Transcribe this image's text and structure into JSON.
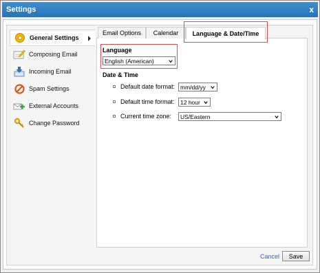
{
  "dialog": {
    "title": "Settings",
    "close_label": "x"
  },
  "sidebar": {
    "items": [
      {
        "label": "General Settings",
        "icon": "gear-icon",
        "active": true
      },
      {
        "label": "Composing Email",
        "icon": "pencil-icon",
        "active": false
      },
      {
        "label": "Incoming Email",
        "icon": "inbox-icon",
        "active": false
      },
      {
        "label": "Spam Settings",
        "icon": "prohibited-icon",
        "active": false
      },
      {
        "label": "External Accounts",
        "icon": "accounts-icon",
        "active": false
      },
      {
        "label": "Change Password",
        "icon": "key-icon",
        "active": false
      }
    ]
  },
  "tabs": [
    {
      "label": "Email Options"
    },
    {
      "label": "Calendar"
    },
    {
      "label": "Language & Date/Time",
      "active": true
    }
  ],
  "language": {
    "heading": "Language",
    "selected": "English (American)"
  },
  "datetime": {
    "heading": "Date & Time",
    "rows": [
      {
        "label": "Default date format:",
        "selected": "mm/dd/yy"
      },
      {
        "label": "Default time format:",
        "selected": "12 hour"
      },
      {
        "label": "Current time zone:",
        "selected": "US/Eastern"
      }
    ]
  },
  "footer": {
    "cancel_label": "Cancel",
    "save_label": "Save"
  },
  "colors": {
    "titlebar": "#2a72b5",
    "highlight_border": "#e14a4a",
    "link": "#2b64b5"
  }
}
